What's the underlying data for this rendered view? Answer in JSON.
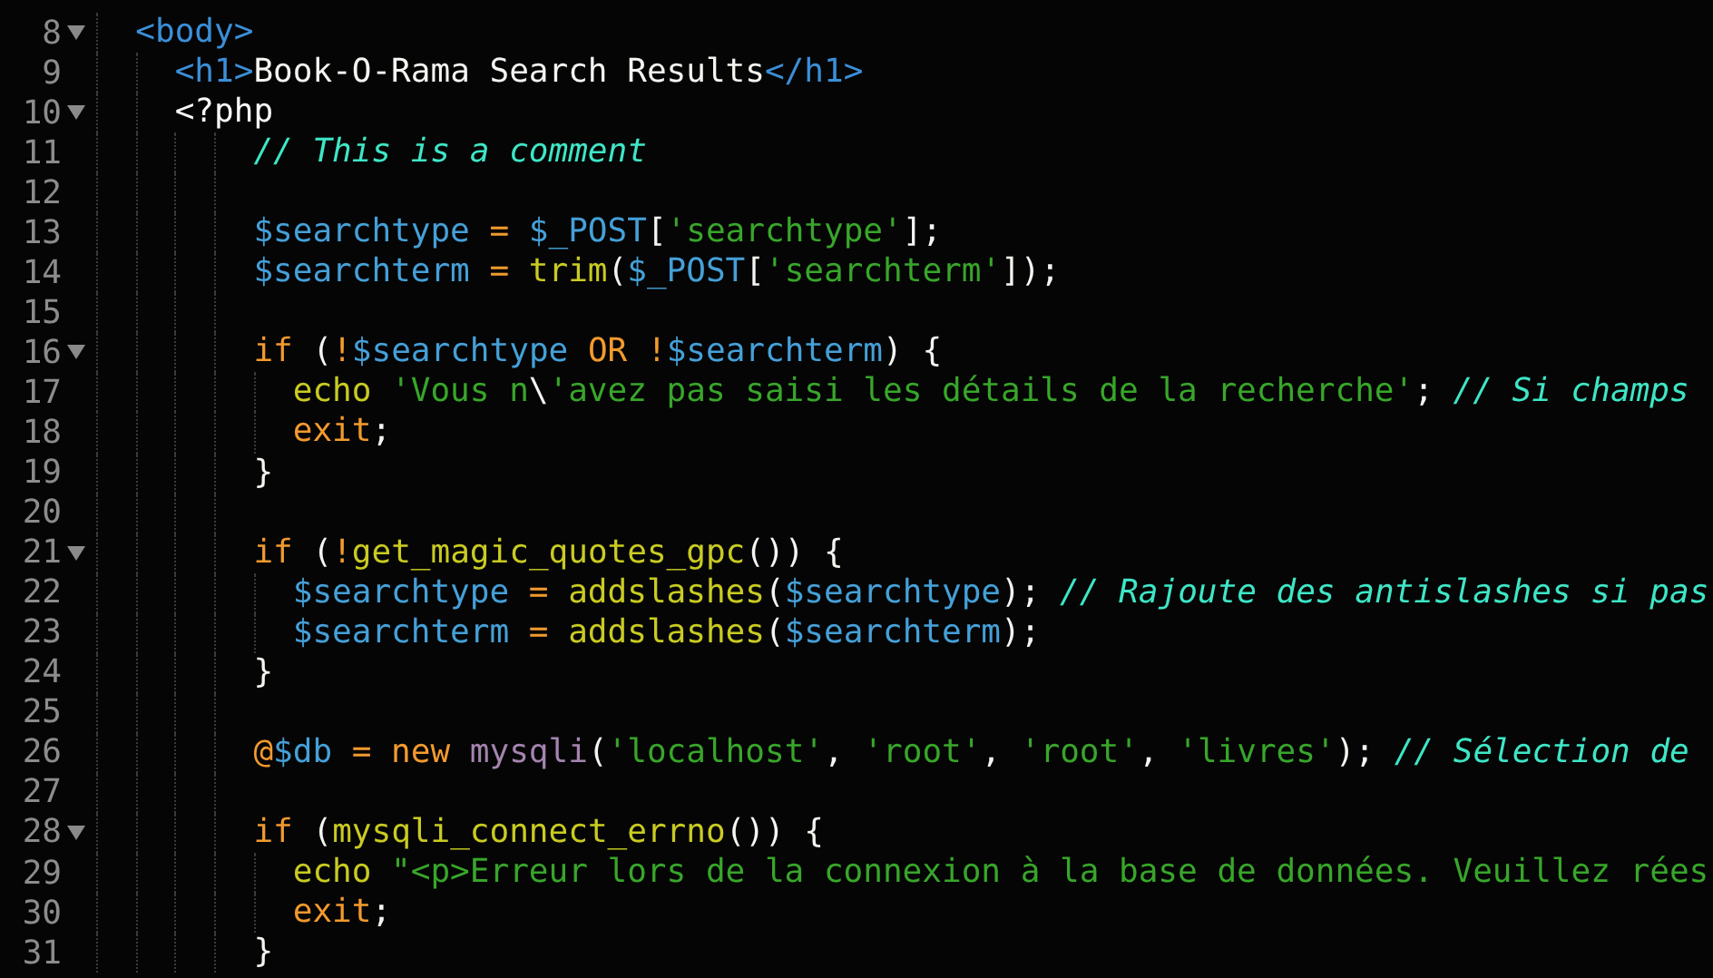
{
  "lines": [
    {
      "number": "8",
      "foldable": true,
      "tokens": [
        {
          "kind": "tag",
          "text": "<body>"
        }
      ],
      "children": [
        {
          "number": "9",
          "foldable": false,
          "tokens": [
            {
              "kind": "tag",
              "text": "<h1>"
            },
            {
              "kind": "plain",
              "text": "Book-O-Rama Search Results"
            },
            {
              "kind": "tag",
              "text": "</h1>"
            }
          ]
        },
        {
          "number": "10",
          "foldable": true,
          "tokens": [
            {
              "kind": "php-open",
              "text": "<?php"
            }
          ],
          "children": [
            {
              "number": "11",
              "foldable": false,
              "tokens": [
                {
                  "kind": "comment",
                  "text": "// This is a comment"
                }
              ]
            },
            {
              "number": "12",
              "foldable": false
            },
            {
              "number": "13",
              "foldable": false,
              "tokens": [
                {
                  "kind": "variable",
                  "text": "$searchtype"
                },
                {
                  "kind": "operator",
                  "text": " = "
                },
                {
                  "kind": "variable",
                  "text": "$_POST"
                },
                {
                  "kind": "plain",
                  "text": "["
                },
                {
                  "kind": "string",
                  "text": "'searchtype'"
                },
                {
                  "kind": "plain",
                  "text": "];"
                }
              ]
            },
            {
              "number": "14",
              "foldable": false,
              "tokens": [
                {
                  "kind": "variable",
                  "text": "$searchterm"
                },
                {
                  "kind": "operator",
                  "text": " = "
                },
                {
                  "kind": "function",
                  "text": "trim"
                },
                {
                  "kind": "plain",
                  "text": "("
                },
                {
                  "kind": "variable",
                  "text": "$_POST"
                },
                {
                  "kind": "plain",
                  "text": "["
                },
                {
                  "kind": "string",
                  "text": "'searchterm'"
                },
                {
                  "kind": "plain",
                  "text": "]);"
                }
              ]
            },
            {
              "number": "15",
              "foldable": false
            },
            {
              "number": "16",
              "foldable": true,
              "tokens": [
                {
                  "kind": "operator",
                  "text": "if"
                },
                {
                  "kind": "plain",
                  "text": " ("
                },
                {
                  "kind": "operator",
                  "text": "!"
                },
                {
                  "kind": "variable",
                  "text": "$searchtype"
                },
                {
                  "kind": "operator",
                  "text": " OR !"
                },
                {
                  "kind": "variable",
                  "text": "$searchterm"
                },
                {
                  "kind": "plain",
                  "text": ") {"
                }
              ],
              "children": [
                {
                  "number": "17",
                  "foldable": false,
                  "tokens": [
                    {
                      "kind": "function",
                      "text": "echo "
                    },
                    {
                      "kind": "string",
                      "text": "'Vous n"
                    },
                    {
                      "kind": "plain",
                      "text": "\\"
                    },
                    {
                      "kind": "string",
                      "text": "'avez pas saisi les détails de la recherche'"
                    },
                    {
                      "kind": "plain",
                      "text": "; "
                    },
                    {
                      "kind": "comment",
                      "text": "// Si champs"
                    }
                  ]
                },
                {
                  "number": "18",
                  "foldable": false,
                  "tokens": [
                    {
                      "kind": "operator",
                      "text": "exit"
                    },
                    {
                      "kind": "plain",
                      "text": ";"
                    }
                  ]
                }
              ]
            },
            {
              "number": "19",
              "foldable": false,
              "tokens": [
                {
                  "kind": "plain",
                  "text": "}"
                }
              ]
            },
            {
              "number": "20",
              "foldable": false
            },
            {
              "number": "21",
              "foldable": true,
              "tokens": [
                {
                  "kind": "operator",
                  "text": "if"
                },
                {
                  "kind": "plain",
                  "text": " ("
                },
                {
                  "kind": "operator",
                  "text": "!"
                },
                {
                  "kind": "function",
                  "text": "get_magic_quotes_gpc"
                },
                {
                  "kind": "plain",
                  "text": "()) {"
                }
              ],
              "children": [
                {
                  "number": "22",
                  "foldable": false,
                  "tokens": [
                    {
                      "kind": "variable",
                      "text": "$searchtype"
                    },
                    {
                      "kind": "operator",
                      "text": " = "
                    },
                    {
                      "kind": "function",
                      "text": "addslashes"
                    },
                    {
                      "kind": "plain",
                      "text": "("
                    },
                    {
                      "kind": "variable",
                      "text": "$searchtype"
                    },
                    {
                      "kind": "plain",
                      "text": "); "
                    },
                    {
                      "kind": "comment",
                      "text": "// Rajoute des antislashes si pas"
                    }
                  ]
                },
                {
                  "number": "23",
                  "foldable": false,
                  "tokens": [
                    {
                      "kind": "variable",
                      "text": "$searchterm"
                    },
                    {
                      "kind": "operator",
                      "text": " = "
                    },
                    {
                      "kind": "function",
                      "text": "addslashes"
                    },
                    {
                      "kind": "plain",
                      "text": "("
                    },
                    {
                      "kind": "variable",
                      "text": "$searchterm"
                    },
                    {
                      "kind": "plain",
                      "text": ");"
                    }
                  ]
                }
              ]
            },
            {
              "number": "24",
              "foldable": false,
              "tokens": [
                {
                  "kind": "plain",
                  "text": "}"
                }
              ]
            },
            {
              "number": "25",
              "foldable": false
            },
            {
              "number": "26",
              "foldable": false,
              "tokens": [
                {
                  "kind": "operator",
                  "text": "@"
                },
                {
                  "kind": "variable",
                  "text": "$db"
                },
                {
                  "kind": "operator",
                  "text": " = new "
                },
                {
                  "kind": "class",
                  "text": "mysqli"
                },
                {
                  "kind": "plain",
                  "text": "("
                },
                {
                  "kind": "string",
                  "text": "'localhost'"
                },
                {
                  "kind": "plain",
                  "text": ", "
                },
                {
                  "kind": "string",
                  "text": "'root'"
                },
                {
                  "kind": "plain",
                  "text": ", "
                },
                {
                  "kind": "string",
                  "text": "'root'"
                },
                {
                  "kind": "plain",
                  "text": ", "
                },
                {
                  "kind": "string",
                  "text": "'livres'"
                },
                {
                  "kind": "plain",
                  "text": "); "
                },
                {
                  "kind": "comment",
                  "text": "// Sélection de"
                }
              ]
            },
            {
              "number": "27",
              "foldable": false
            },
            {
              "number": "28",
              "foldable": true,
              "tokens": [
                {
                  "kind": "operator",
                  "text": "if"
                },
                {
                  "kind": "plain",
                  "text": " ("
                },
                {
                  "kind": "function",
                  "text": "mysqli_connect_errno"
                },
                {
                  "kind": "plain",
                  "text": "()) {"
                }
              ],
              "children": [
                {
                  "number": "29",
                  "foldable": false,
                  "tokens": [
                    {
                      "kind": "function",
                      "text": "echo "
                    },
                    {
                      "kind": "string",
                      "text": "\"<p>Erreur lors de la connexion à la base de données. Veuillez rées"
                    }
                  ]
                },
                {
                  "number": "30",
                  "foldable": false,
                  "tokens": [
                    {
                      "kind": "operator",
                      "text": "exit"
                    },
                    {
                      "kind": "plain",
                      "text": ";"
                    }
                  ]
                }
              ]
            },
            {
              "number": "31",
              "foldable": false,
              "tokens": [
                {
                  "kind": "plain",
                  "text": "}"
                }
              ]
            }
          ]
        }
      ]
    }
  ]
}
